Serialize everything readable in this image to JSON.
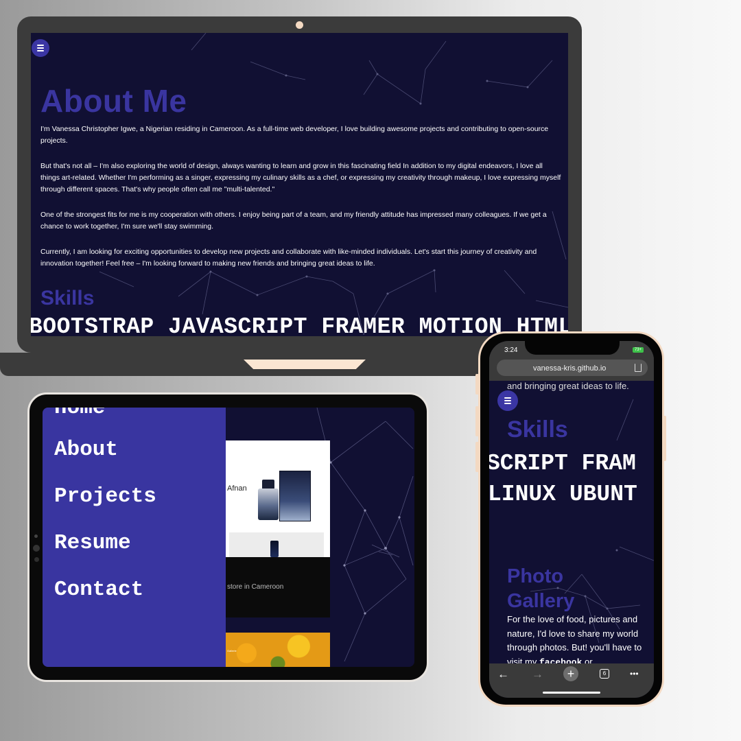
{
  "laptop": {
    "title": "About Me",
    "paragraphs": [
      "I'm Vanessa Christopher Igwe, a Nigerian residing in Cameroon. As a full-time web developer, I love building awesome projects and contributing to open-source projects.",
      "But that's not all – I'm also exploring the world of design, always wanting to learn and grow in this fascinating field In addition to my digital endeavors, I love all things art-related. Whether I'm performing as a singer, expressing my culinary skills as a chef, or expressing my creativity through makeup, I love expressing myself through different spaces. That's why people often call me \"multi-talented.\"",
      "One of the strongest fits for me is my cooperation with others. I enjoy being part of a team, and my friendly attitude has impressed many colleagues. If we get a chance to work together, I'm sure we'll stay swimming.",
      "Currently, I am looking for exciting opportunities to develop new projects and collaborate with like-minded individuals. Let's start this journey of creativity and innovation together! Feel free – I'm looking forward to making new friends and bringing great ideas to life."
    ],
    "skills_heading": "Skills",
    "skills_marquee": "BOOTSTRAP JAVASCRIPT FRAMER MOTION HTML BO"
  },
  "tablet": {
    "menu": {
      "partial_item": "Home",
      "items": [
        "About",
        "Projects",
        "Resume",
        "Contact"
      ]
    },
    "preview": {
      "brand": "Afnan",
      "dark_text": "store in Cameroon",
      "flowers_text": "Gallerie"
    }
  },
  "phone": {
    "time": "3:24",
    "battery": "73+",
    "url": "vanessa-kris.github.io",
    "prev_text": "and bringing great ideas to life.",
    "skills_heading": "Skills",
    "marquee_line1": "SCRIPT FRAM",
    "marquee_line2": "LINUX UBUNT",
    "gallery_heading": "Photo Gallery",
    "gallery_text_before": "For the love of food, pictures and nature, I'd love to share my world through photos. But! you'll have to visit my",
    "gallery_link": "facebook",
    "gallery_text_after": "or",
    "toolbar": {
      "back": "←",
      "forward": "→",
      "new_tab": "+",
      "tab_count": "6",
      "more": "•••"
    }
  }
}
